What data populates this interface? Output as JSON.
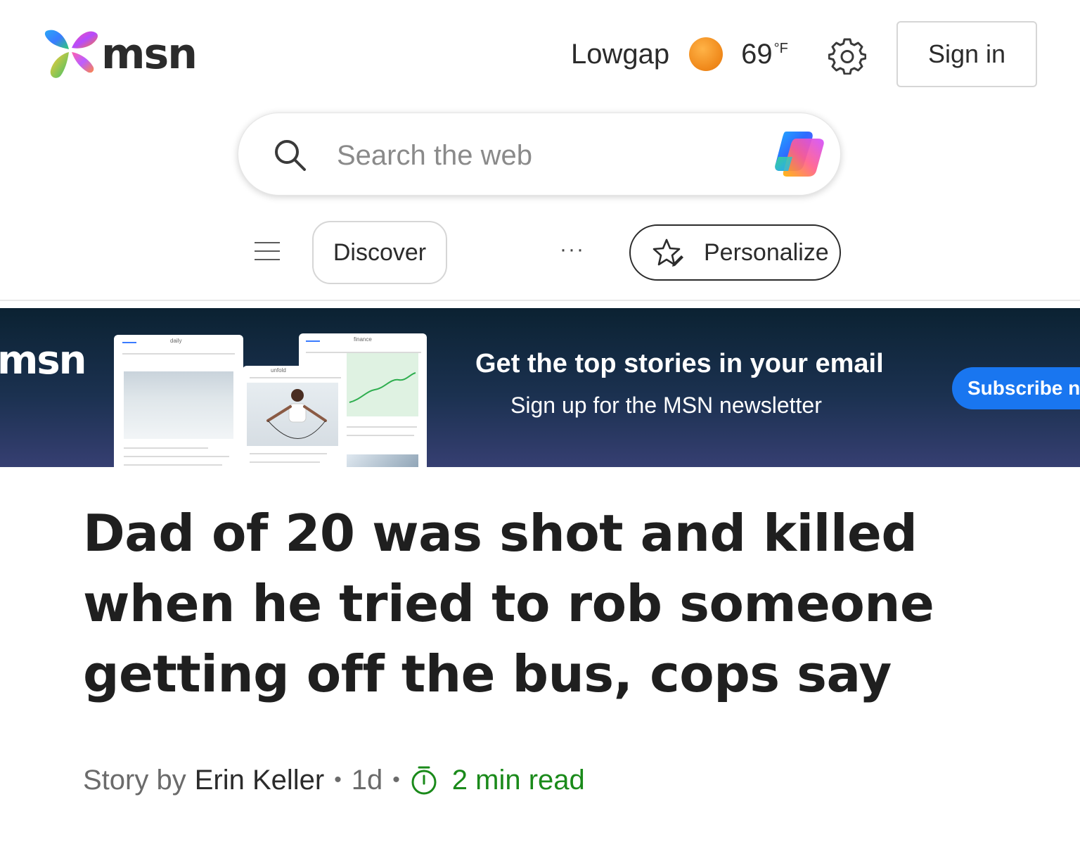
{
  "header": {
    "logo_text": "msn",
    "location": "Lowgap",
    "temperature": "69",
    "temperature_unit": "°F",
    "weather_icon": "sun-icon",
    "settings_icon": "gear-icon",
    "signin_label": "Sign in"
  },
  "search": {
    "placeholder": "Search the web",
    "search_icon": "search-icon",
    "copilot_icon": "copilot-icon"
  },
  "nav": {
    "menu_icon": "hamburger-icon",
    "discover_label": "Discover",
    "more_label": "···",
    "personalize_label": "Personalize",
    "personalize_icon": "star-edit-icon"
  },
  "banner": {
    "logo_text": "msn",
    "title": "Get the top stories in your email",
    "subtitle": "Sign up for the MSN newsletter",
    "subscribe_label": "Subscribe n",
    "card_labels": [
      "daily",
      "unfold",
      "finance"
    ]
  },
  "article": {
    "headline": "Dad of 20 was shot and killed when he tried to rob someone getting off the bus, cops say",
    "story_by": "Story by",
    "author": "Erin Keller",
    "age": "1d",
    "read_time": "2 min read",
    "read_time_icon": "timer-icon"
  },
  "colors": {
    "accent_blue": "#1976f0",
    "read_time_green": "#1a8a1a",
    "banner_dark": "#0b2232",
    "sun_orange": "#f08a1c"
  }
}
